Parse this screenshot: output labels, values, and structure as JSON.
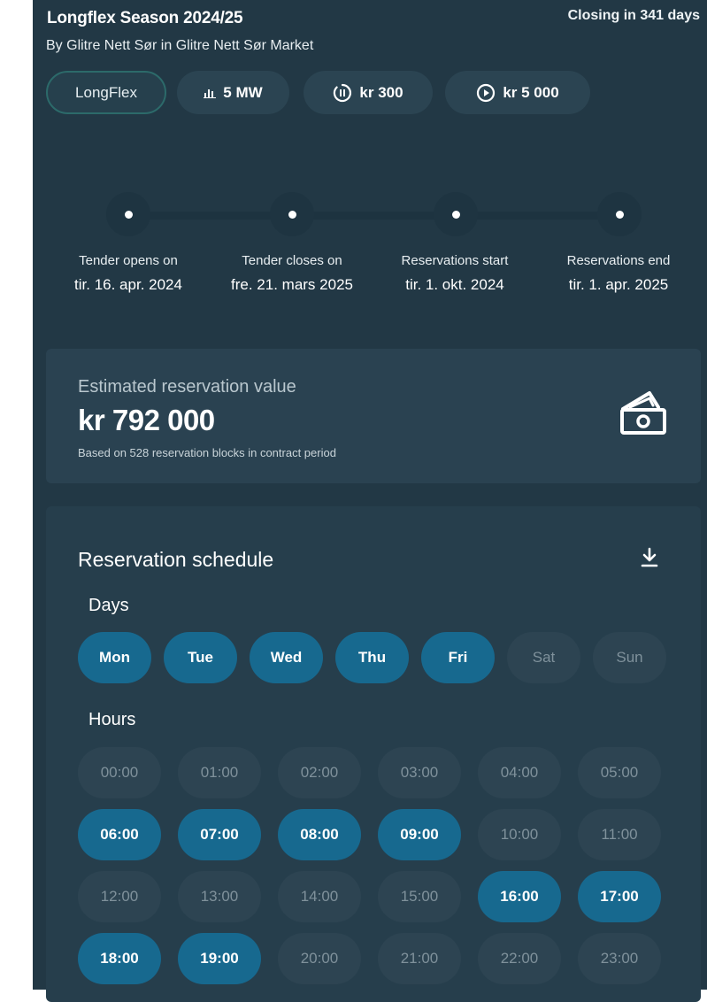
{
  "header": {
    "title": "Longflex Season 2024/25",
    "subtitle": "By Glitre Nett Sør in Glitre Nett Sør Market",
    "closing": "Closing in 341 days"
  },
  "chips": [
    {
      "label": "LongFlex",
      "icon": ""
    },
    {
      "label": "5 MW",
      "icon": "bar-chart-icon"
    },
    {
      "label": "kr 300",
      "icon": "pause-circle-icon"
    },
    {
      "label": "kr 5 000",
      "icon": "play-circle-icon"
    }
  ],
  "timeline": [
    {
      "label": "Tender opens on",
      "date": "tir. 16. apr. 2024"
    },
    {
      "label": "Tender closes on",
      "date": "fre. 21. mars 2025"
    },
    {
      "label": "Reservations start",
      "date": "tir. 1. okt. 2024"
    },
    {
      "label": "Reservations end",
      "date": "tir. 1. apr. 2025"
    }
  ],
  "estimate": {
    "label": "Estimated reservation value",
    "value": "kr 792 000",
    "note": "Based on 528 reservation blocks in contract period",
    "icon": "money-icon"
  },
  "schedule": {
    "title": "Reservation schedule",
    "download_icon": "download-icon",
    "days_label": "Days",
    "hours_label": "Hours",
    "days": [
      {
        "label": "Mon",
        "selected": true
      },
      {
        "label": "Tue",
        "selected": true
      },
      {
        "label": "Wed",
        "selected": true
      },
      {
        "label": "Thu",
        "selected": true
      },
      {
        "label": "Fri",
        "selected": true
      },
      {
        "label": "Sat",
        "selected": false
      },
      {
        "label": "Sun",
        "selected": false
      }
    ],
    "hours": [
      {
        "label": "00:00",
        "selected": false
      },
      {
        "label": "01:00",
        "selected": false
      },
      {
        "label": "02:00",
        "selected": false
      },
      {
        "label": "03:00",
        "selected": false
      },
      {
        "label": "04:00",
        "selected": false
      },
      {
        "label": "05:00",
        "selected": false
      },
      {
        "label": "06:00",
        "selected": true
      },
      {
        "label": "07:00",
        "selected": true
      },
      {
        "label": "08:00",
        "selected": true
      },
      {
        "label": "09:00",
        "selected": true
      },
      {
        "label": "10:00",
        "selected": false
      },
      {
        "label": "11:00",
        "selected": false
      },
      {
        "label": "12:00",
        "selected": false
      },
      {
        "label": "13:00",
        "selected": false
      },
      {
        "label": "14:00",
        "selected": false
      },
      {
        "label": "15:00",
        "selected": false
      },
      {
        "label": "16:00",
        "selected": true
      },
      {
        "label": "17:00",
        "selected": true
      },
      {
        "label": "18:00",
        "selected": true
      },
      {
        "label": "19:00",
        "selected": true
      },
      {
        "label": "20:00",
        "selected": false
      },
      {
        "label": "21:00",
        "selected": false
      },
      {
        "label": "22:00",
        "selected": false
      },
      {
        "label": "23:00",
        "selected": false
      }
    ]
  },
  "colors": {
    "background": "#223845",
    "card": "#2a4251",
    "selected": "#17698f",
    "unselected": "#2d4452",
    "chip_outline": "#2c6a6a"
  }
}
